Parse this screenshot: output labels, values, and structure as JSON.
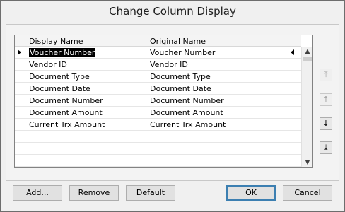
{
  "dialog": {
    "title": "Change Column Display"
  },
  "grid": {
    "columns": [
      "Display Name",
      "Original Name"
    ],
    "rows": [
      {
        "display": "Voucher Number",
        "original": "Voucher Number",
        "selected": true
      },
      {
        "display": "Vendor ID",
        "original": "Vendor ID"
      },
      {
        "display": "Document Type",
        "original": "Document Type"
      },
      {
        "display": "Document Date",
        "original": "Document Date"
      },
      {
        "display": "Document Number",
        "original": "Document Number"
      },
      {
        "display": "Document Amount",
        "original": "Document Amount"
      },
      {
        "display": "Current Trx Amount",
        "original": "Current Trx Amount"
      }
    ]
  },
  "icons": {
    "move_top": "move-top-icon",
    "move_up": "move-up-icon",
    "move_down": "move-down-icon",
    "move_bottom": "move-bottom-icon"
  },
  "buttons": {
    "add": "Add...",
    "remove": "Remove",
    "default": "Default",
    "ok": "OK",
    "cancel": "Cancel"
  }
}
